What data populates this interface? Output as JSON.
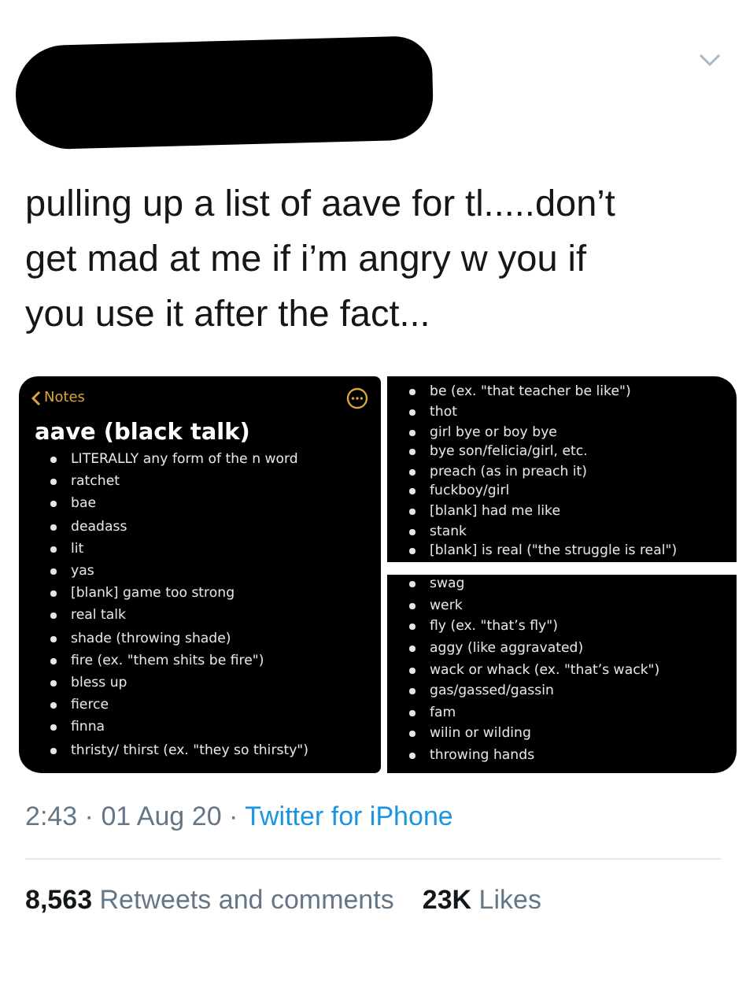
{
  "tweet": {
    "text": "pulling up a list of aave for tl.....don’t get mad at me if i’m angry w you if you use it after the fact...",
    "notes_panels": [
      {
        "kind": "note",
        "back_label": "Notes",
        "title": "aave (black talk)",
        "items": [
          "LITERALLY any form of the n word",
          "ratchet",
          "bae",
          "deadass",
          "lit",
          "yas",
          "[blank] game too strong",
          "real talk",
          "shade (throwing shade)",
          "fire (ex. \"them shits be fire\")",
          "bless up",
          "fierce",
          "finna",
          "thristy/ thirst (ex. \"they so thirsty\")"
        ]
      },
      {
        "kind": "continuation",
        "items": [
          "be (ex. \"that teacher be like\")",
          "thot",
          "girl bye or boy bye",
          "bye son/felicia/girl, etc.",
          "preach (as in preach it)",
          "fuckboy/girl",
          "[blank] had me like",
          "stank",
          "[blank] is real (\"the struggle is real\")"
        ]
      },
      {
        "kind": "continuation",
        "items": [
          "swag",
          "werk",
          "fly (ex. \"that’s fly\")",
          "aggy (like aggravated)",
          "wack or whack (ex. \"that’s wack\")",
          "gas/gassed/gassin",
          "fam",
          "wilin or wilding",
          "throwing hands"
        ]
      }
    ],
    "timestamp": "2:43 · 01 Aug 20 · ",
    "source": "Twitter for iPhone",
    "stats": [
      {
        "count": "8,563",
        "label": "Retweets and comments"
      },
      {
        "count": "23K",
        "label": "Likes"
      }
    ]
  }
}
